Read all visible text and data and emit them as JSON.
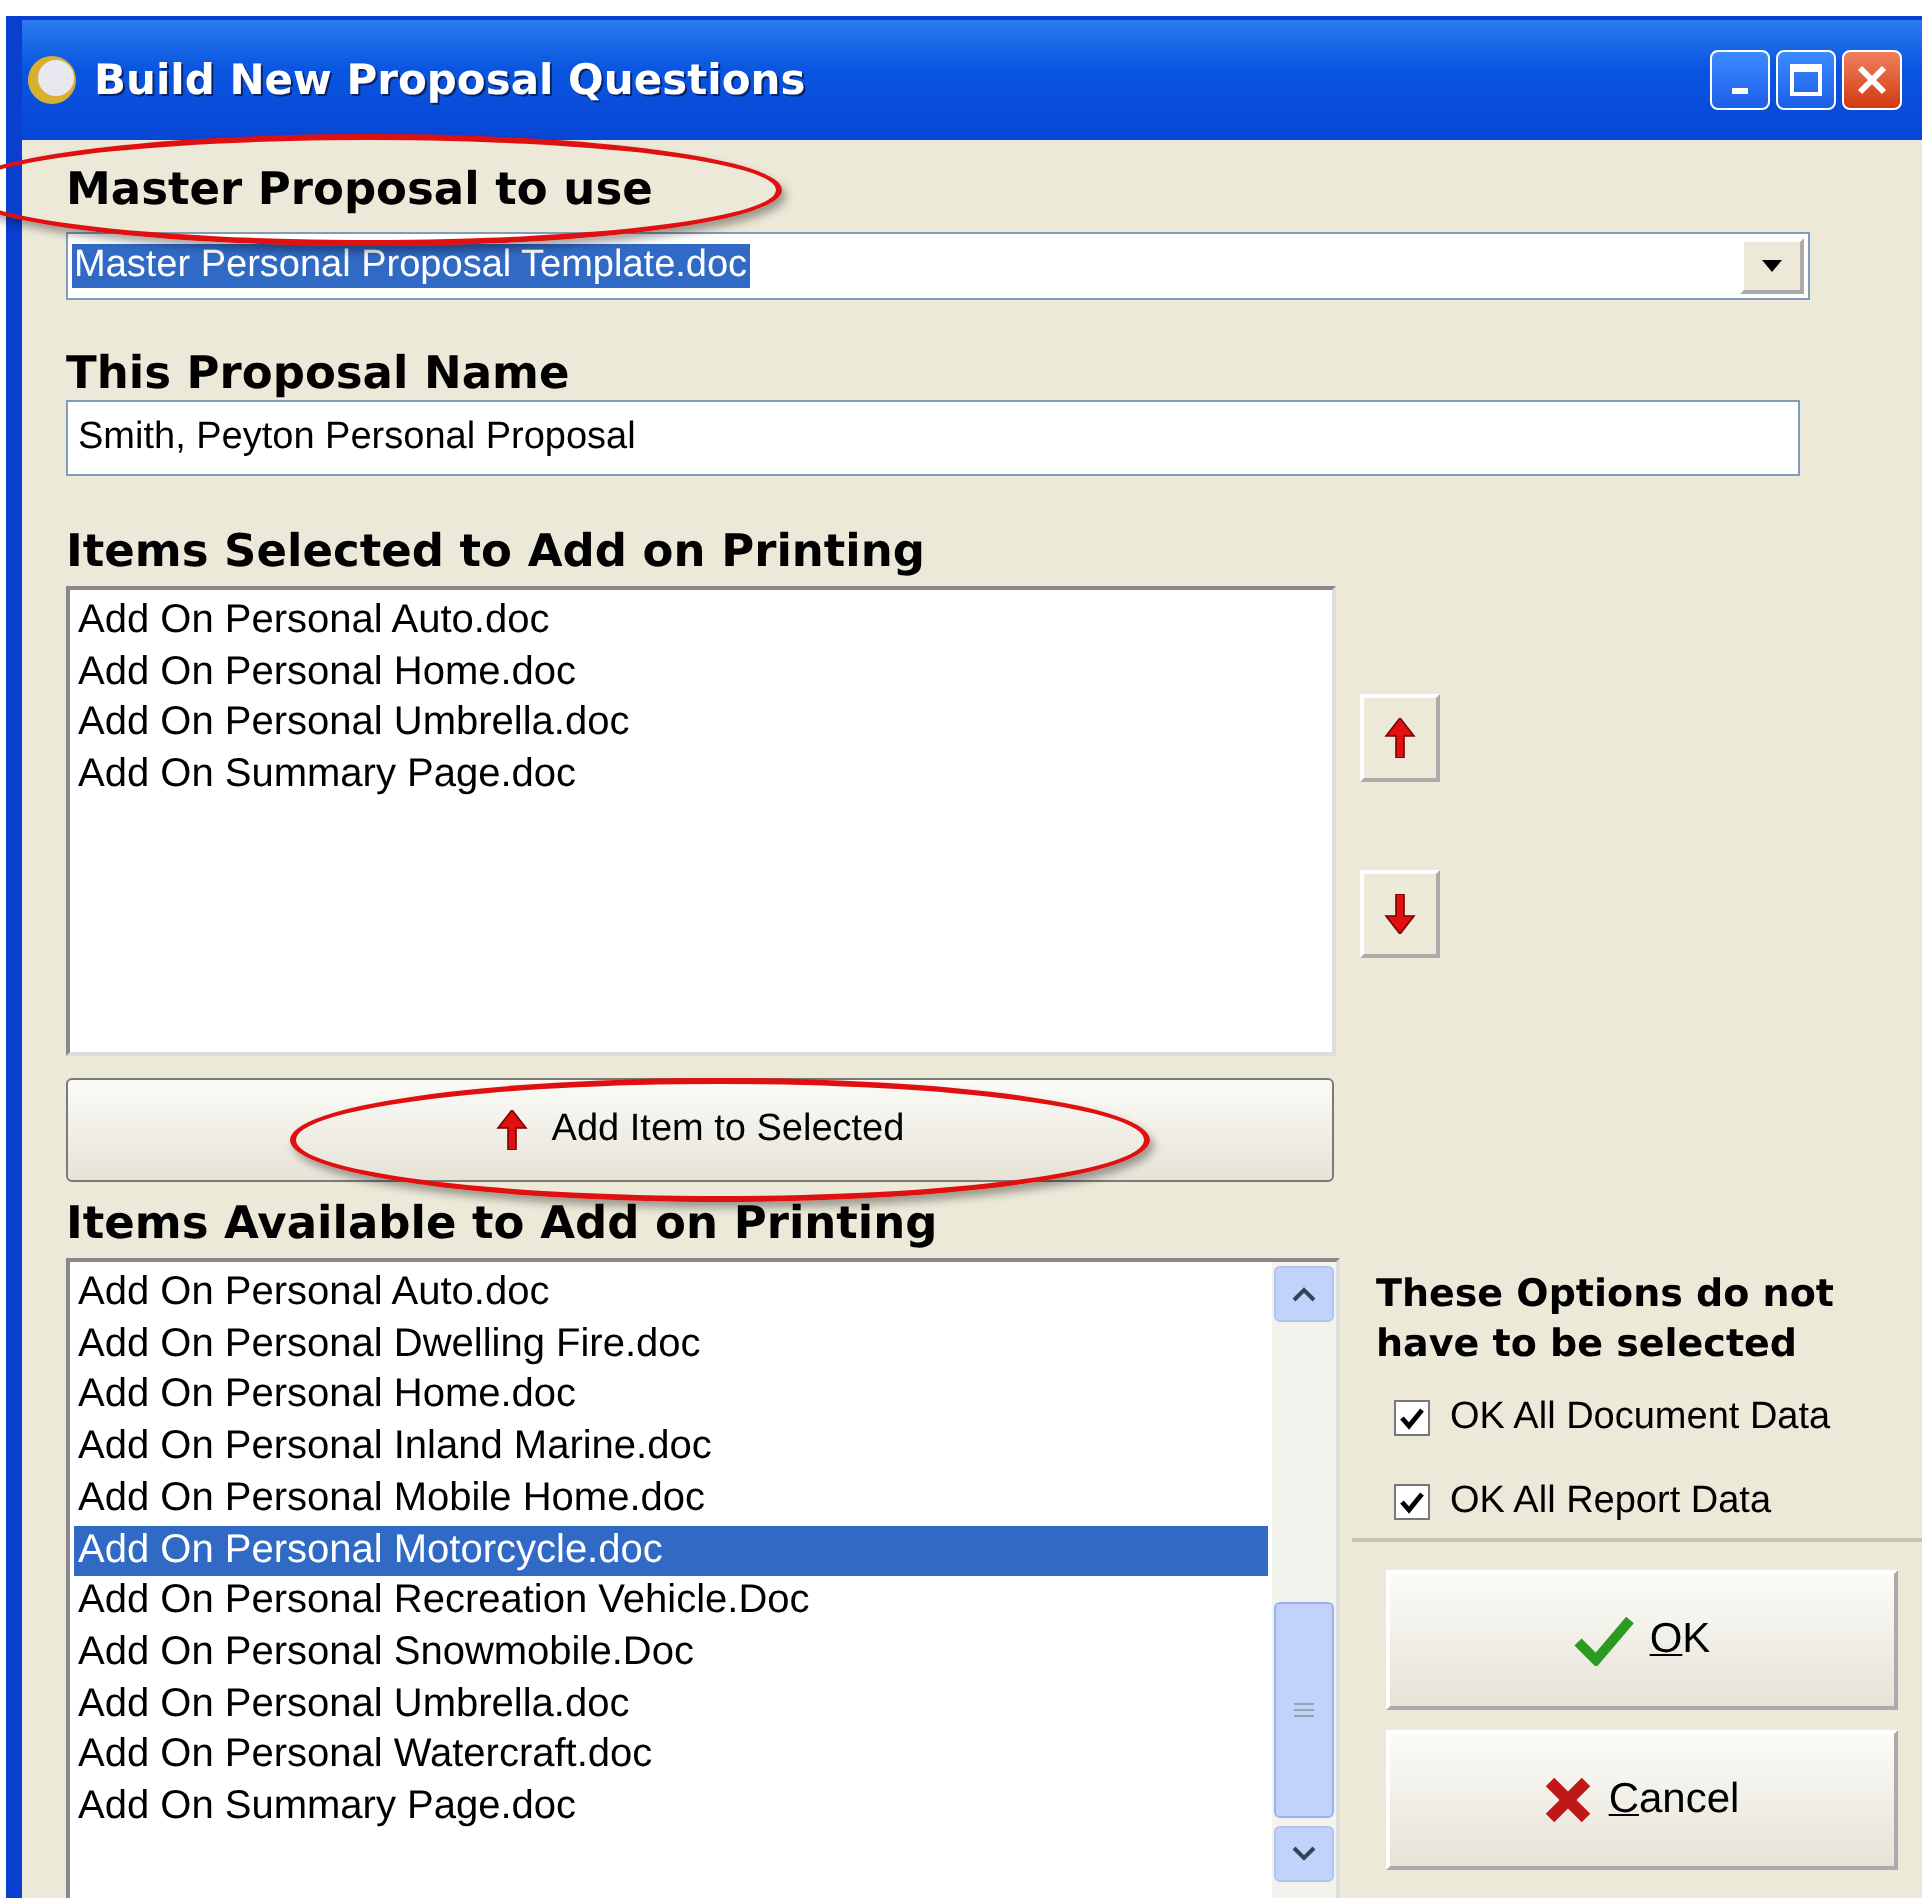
{
  "window": {
    "title": "Build New Proposal Questions"
  },
  "master_proposal": {
    "label": "Master Proposal to use",
    "value": "Master Personal Proposal Template.doc",
    "highlighted": true
  },
  "proposal_name": {
    "label": "This Proposal Name",
    "value": "Smith, Peyton Personal Proposal"
  },
  "selected_items": {
    "label": "Items Selected to Add on Printing",
    "items": [
      {
        "text": "Add On Personal Auto.doc",
        "selected": false
      },
      {
        "text": "Add On Personal Home.doc",
        "selected": false
      },
      {
        "text": "Add On Personal Umbrella.doc",
        "selected": false
      },
      {
        "text": "Add On Summary Page.doc",
        "selected": false
      }
    ]
  },
  "add_button": {
    "label": "Add Item to Selected",
    "highlighted": true
  },
  "available_items": {
    "label": "Items Available to Add on Printing",
    "items": [
      {
        "text": "Add On Personal Auto.doc",
        "selected": false
      },
      {
        "text": "Add On Personal Dwelling Fire.doc",
        "selected": false
      },
      {
        "text": "Add On Personal Home.doc",
        "selected": false
      },
      {
        "text": "Add On Personal Inland Marine.doc",
        "selected": false
      },
      {
        "text": "Add On Personal Mobile Home.doc",
        "selected": false
      },
      {
        "text": "Add On Personal Motorcycle.doc",
        "selected": true
      },
      {
        "text": "Add On Personal Recreation Vehicle.Doc",
        "selected": false
      },
      {
        "text": "Add On Personal Snowmobile.Doc",
        "selected": false
      },
      {
        "text": "Add On Personal Umbrella.doc",
        "selected": false
      },
      {
        "text": "Add On Personal Watercraft.doc",
        "selected": false
      },
      {
        "text": "Add On Summary Page.doc",
        "selected": false
      }
    ]
  },
  "options": {
    "heading": "These Options do not have to be selected",
    "checkboxes": [
      {
        "label": "OK All Document Data",
        "checked": true
      },
      {
        "label": "OK All Report Data",
        "checked": true
      }
    ]
  },
  "buttons": [
    {
      "kind": "ok",
      "label": "OK"
    },
    {
      "kind": "cancel",
      "label": "Cancel"
    }
  ]
}
